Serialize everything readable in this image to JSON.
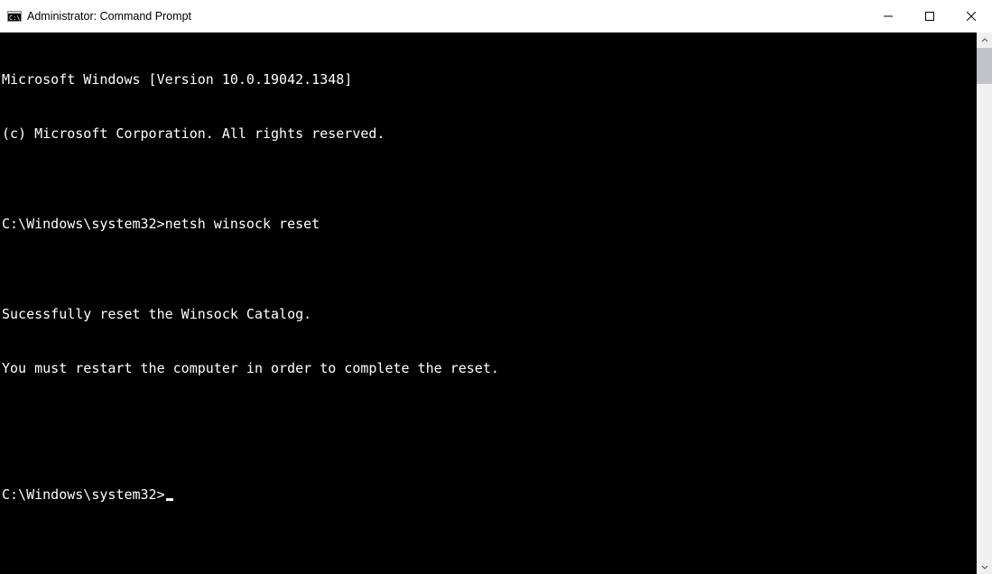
{
  "titlebar": {
    "title": "Administrator: Command Prompt"
  },
  "terminal": {
    "version_line": "Microsoft Windows [Version 10.0.19042.1348]",
    "copyright_line": "(c) Microsoft Corporation. All rights reserved.",
    "blank1": "",
    "prompt1": "C:\\Windows\\system32>",
    "command1": "netsh winsock reset",
    "blank2": "",
    "result_line1": "Sucessfully reset the Winsock Catalog.",
    "result_line2": "You must restart the computer in order to complete the reset.",
    "blank3": "",
    "blank4": "",
    "prompt2": "C:\\Windows\\system32>"
  },
  "icons": {
    "app_icon": "cmd-icon",
    "minimize": "minimize",
    "maximize": "maximize",
    "close": "close",
    "scroll_up": "chevron-up",
    "scroll_down": "chevron-down"
  }
}
